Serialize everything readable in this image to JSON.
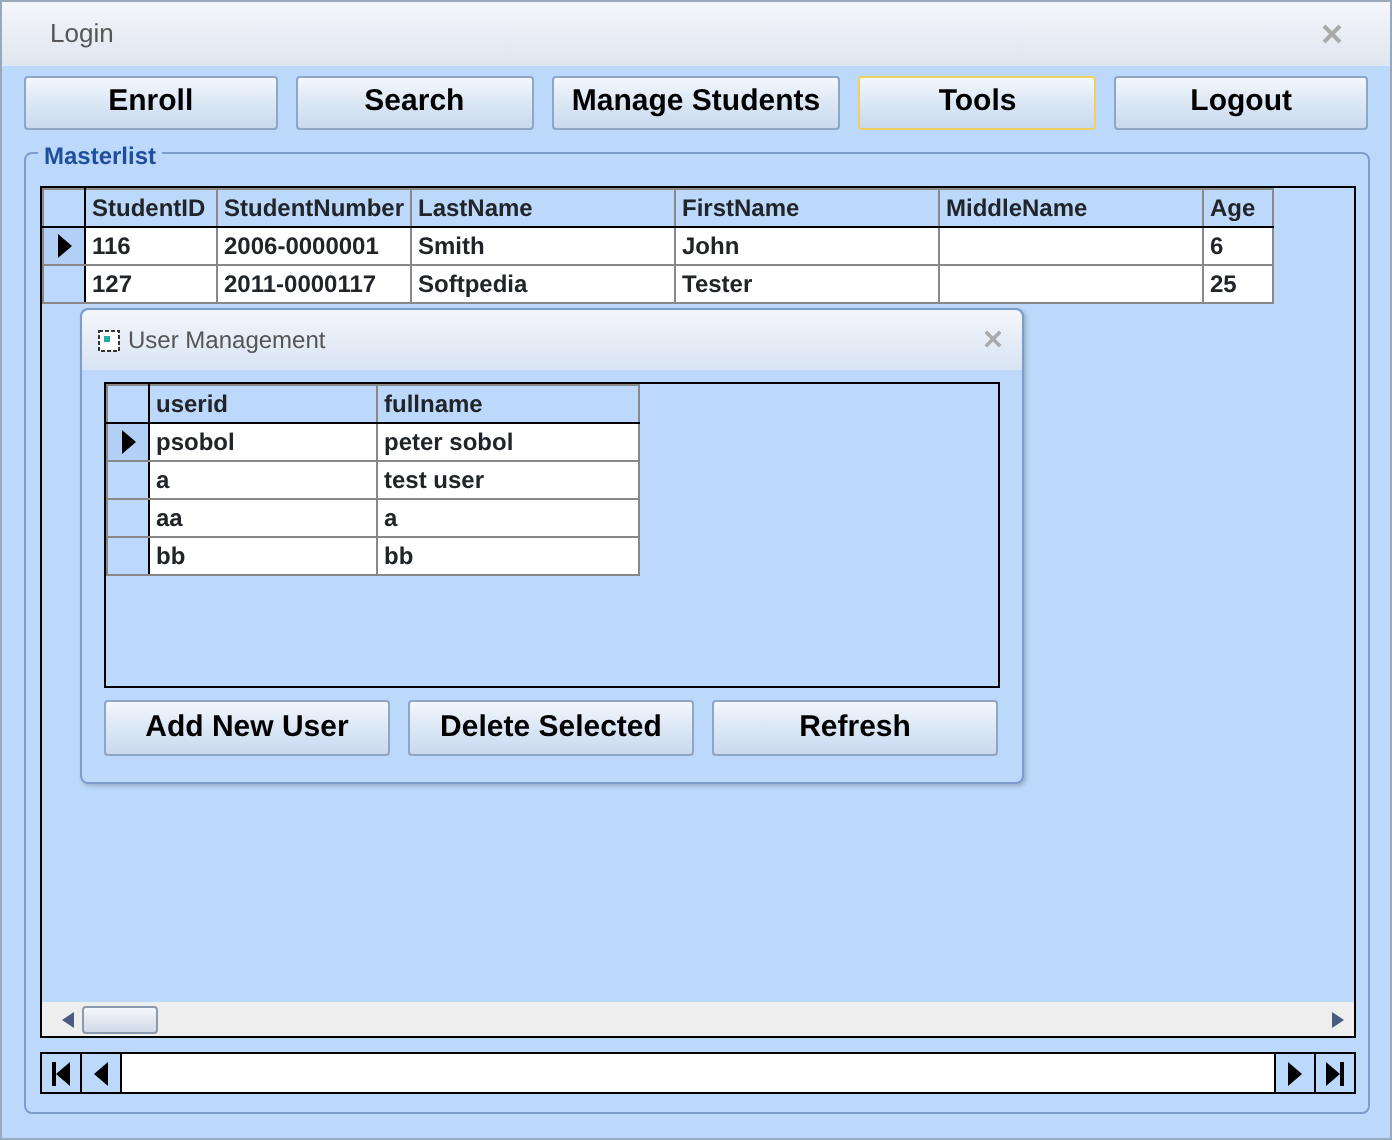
{
  "window": {
    "title": "Login"
  },
  "nav_buttons": [
    {
      "label": "Enroll",
      "selected": false
    },
    {
      "label": "Search",
      "selected": false
    },
    {
      "label": "Manage Students",
      "selected": false
    },
    {
      "label": "Tools",
      "selected": true
    },
    {
      "label": "Logout",
      "selected": false
    }
  ],
  "masterlist": {
    "title": "Masterlist",
    "columns": [
      "StudentID",
      "StudentNumber",
      "LastName",
      "FirstName",
      "MiddleName",
      "Age"
    ],
    "rows": [
      {
        "selected": true,
        "cells": [
          "116",
          "2006-0000001",
          "Smith",
          "John",
          "",
          "6"
        ]
      },
      {
        "selected": false,
        "cells": [
          "127",
          "2011-0000117",
          "Softpedia",
          "Tester",
          "",
          "25"
        ]
      }
    ]
  },
  "dialog": {
    "title": "User Management",
    "columns": [
      "userid",
      "fullname"
    ],
    "rows": [
      {
        "selected": true,
        "cells": [
          "psobol",
          "peter sobol"
        ]
      },
      {
        "selected": false,
        "cells": [
          "a",
          "test user"
        ]
      },
      {
        "selected": false,
        "cells": [
          "aa",
          "a"
        ]
      },
      {
        "selected": false,
        "cells": [
          "bb",
          "bb"
        ]
      }
    ],
    "buttons": [
      "Add New User",
      "Delete Selected",
      "Refresh"
    ]
  }
}
